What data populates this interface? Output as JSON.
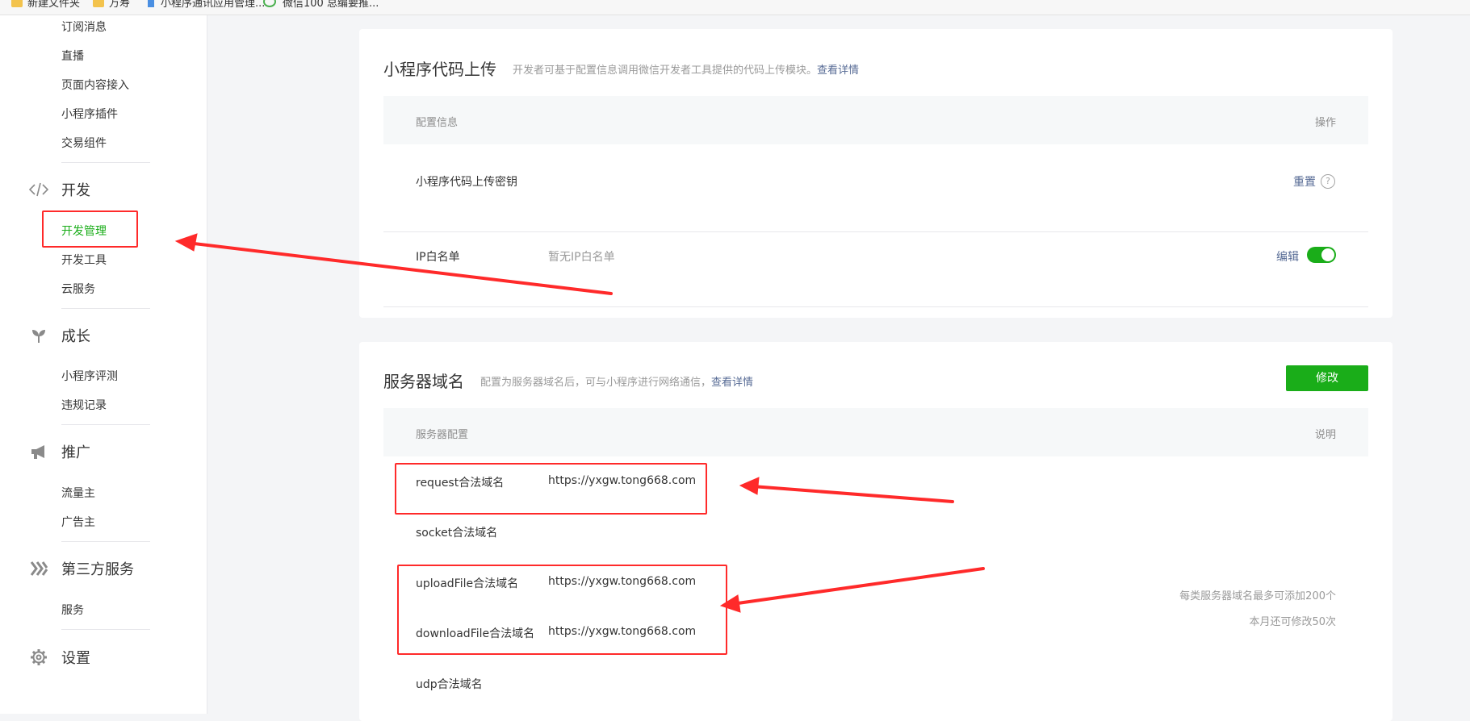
{
  "bookmarks": [
    {
      "label": "新建文件夹",
      "icon": "folder-icon"
    },
    {
      "label": "万寿",
      "icon": "folder-icon"
    },
    {
      "label": "小程序通讯应用管理...",
      "icon": "document-icon"
    },
    {
      "label": "微信100 总编要推...",
      "icon": "wechat-icon"
    }
  ],
  "sidebar": {
    "items_top": [
      "订阅消息",
      "直播",
      "页面内容接入",
      "小程序插件",
      "交易组件"
    ],
    "groups": [
      {
        "label": "开发",
        "icon": "code-icon",
        "items": [
          "开发管理",
          "开发工具",
          "云服务"
        ],
        "active": "开发管理"
      },
      {
        "label": "成长",
        "icon": "sprout-icon",
        "items": [
          "小程序评测",
          "违规记录"
        ]
      },
      {
        "label": "推广",
        "icon": "megaphone-icon",
        "items": [
          "流量主",
          "广告主"
        ]
      },
      {
        "label": "第三方服务",
        "icon": "third-party-icon",
        "items": [
          "服务"
        ]
      },
      {
        "label": "设置",
        "icon": "gear-icon",
        "items": []
      }
    ]
  },
  "upload_card": {
    "title": "小程序代码上传",
    "desc": "开发者可基于配置信息调用微信开发者工具提供的代码上传模块。",
    "detail_link": "查看详情",
    "header_left": "配置信息",
    "header_right": "操作",
    "rows": [
      {
        "label": "小程序代码上传密钥",
        "value": "",
        "action": "重置",
        "help": "?"
      },
      {
        "label": "IP白名单",
        "value": "暂无IP白名单",
        "action": "编辑",
        "toggle_on": true
      }
    ]
  },
  "server_card": {
    "title": "服务器域名",
    "desc": "配置为服务器域名后，可与小程序进行网络通信，",
    "detail_link": "查看详情",
    "modify_button": "修改",
    "header_left": "服务器配置",
    "header_right": "说明",
    "rows": [
      {
        "label": "request合法域名",
        "value": "https://yxgw.tong668.com"
      },
      {
        "label": "socket合法域名",
        "value": ""
      },
      {
        "label": "uploadFile合法域名",
        "value": "https://yxgw.tong668.com"
      },
      {
        "label": "downloadFile合法域名",
        "value": "https://yxgw.tong668.com"
      },
      {
        "label": "udp合法域名",
        "value": ""
      }
    ],
    "notes": [
      "每类服务器域名最多可添加200个",
      "本月还可修改50次"
    ]
  },
  "colors": {
    "accent_green": "#1aad19",
    "link_blue": "#576b95",
    "annotation_red": "#ff2a2a"
  }
}
